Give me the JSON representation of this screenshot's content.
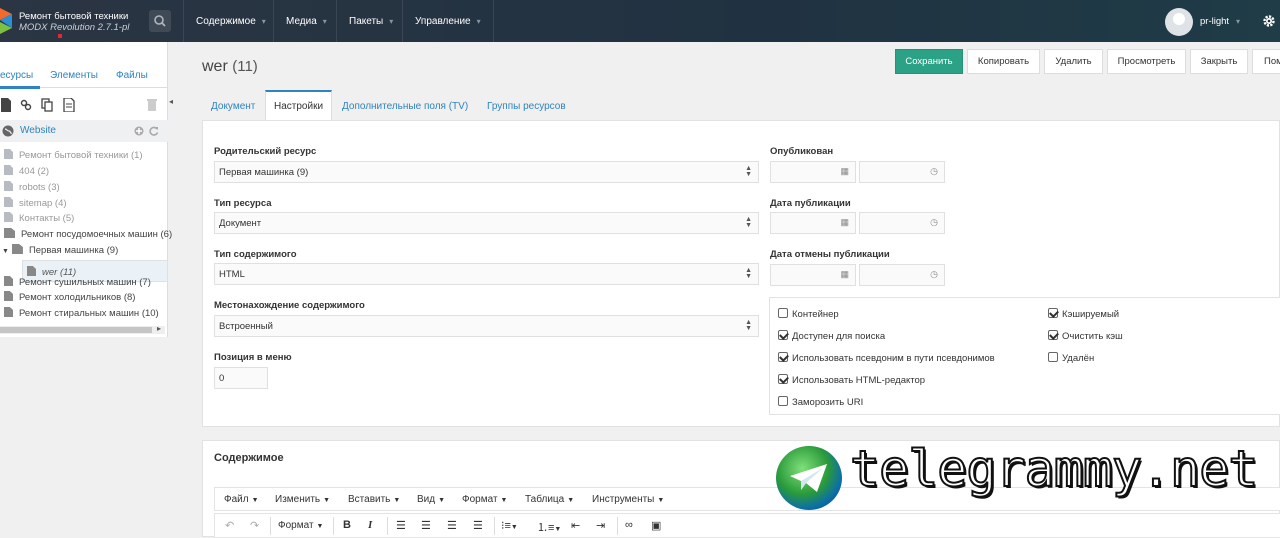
{
  "header": {
    "site_name": "Ремонт бытовой техники",
    "version": "MODX Revolution 2.7.1-pl",
    "nav": [
      {
        "label": "Содержимое"
      },
      {
        "label": "Медиа"
      },
      {
        "label": "Пакеты"
      },
      {
        "label": "Управление"
      }
    ],
    "username": "pr-light"
  },
  "sidebar": {
    "tabs": [
      {
        "label": "есурсы"
      },
      {
        "label": "Элементы"
      },
      {
        "label": "Файлы"
      }
    ],
    "context_label": "Website",
    "tree": [
      {
        "label": "Ремонт бытовой техники (1)"
      },
      {
        "label": "404 (2)"
      },
      {
        "label": "robots (3)"
      },
      {
        "label": "sitemap (4)"
      },
      {
        "label": "Контакты (5)"
      },
      {
        "label": "Ремонт посудомоечных машин (6)"
      },
      {
        "label": "Первая машинка (9)"
      },
      {
        "label": "wer (11)"
      },
      {
        "label": "Ремонт сушильных машин (7)"
      },
      {
        "label": "Ремонт холодильников (8)"
      },
      {
        "label": "Ремонт стиральных машин (10)"
      }
    ]
  },
  "resource": {
    "title": "wer",
    "id_label": "(11)"
  },
  "actions": {
    "save": "Сохранить",
    "copy": "Копировать",
    "delete": "Удалить",
    "view": "Просмотреть",
    "close": "Закрыть",
    "help": "Пом"
  },
  "tabs": [
    {
      "label": "Документ"
    },
    {
      "label": "Настройки"
    },
    {
      "label": "Дополнительные поля (TV)"
    },
    {
      "label": "Группы ресурсов"
    }
  ],
  "settings": {
    "parent_label": "Родительский ресурс",
    "parent_value": "Первая машинка (9)",
    "type_label": "Тип ресурса",
    "type_value": "Документ",
    "content_type_label": "Тип содержимого",
    "content_type_value": "HTML",
    "disposition_label": "Местонахождение содержимого",
    "disposition_value": "Встроенный",
    "menuindex_label": "Позиция в меню",
    "menuindex_value": "0",
    "published_label": "Опубликован",
    "pub_date_label": "Дата публикации",
    "unpub_date_label": "Дата отмены публикации"
  },
  "checkboxes": [
    {
      "label": "Контейнер",
      "checked": false
    },
    {
      "label": "Доступен для поиска",
      "checked": true
    },
    {
      "label": "Использовать псевдоним в пути псевдонимов",
      "checked": true
    },
    {
      "label": "Использовать HTML-редактор",
      "checked": true
    },
    {
      "label": "Заморозить URI",
      "checked": false
    },
    {
      "label": "Кэшируемый",
      "checked": true
    },
    {
      "label": "Очистить кэш",
      "checked": true
    },
    {
      "label": "Удалён",
      "checked": false
    }
  ],
  "content": {
    "title": "Содержимое",
    "menu": [
      {
        "label": "Файл"
      },
      {
        "label": "Изменить"
      },
      {
        "label": "Вставить"
      },
      {
        "label": "Вид"
      },
      {
        "label": "Формат"
      },
      {
        "label": "Таблица"
      },
      {
        "label": "Инструменты"
      }
    ],
    "format_label": "Формат"
  },
  "watermark": {
    "text": "telegrammy.net"
  },
  "colors": {
    "topbar": "#203241",
    "accent": "#2f83c0",
    "save": "#2ba186"
  }
}
